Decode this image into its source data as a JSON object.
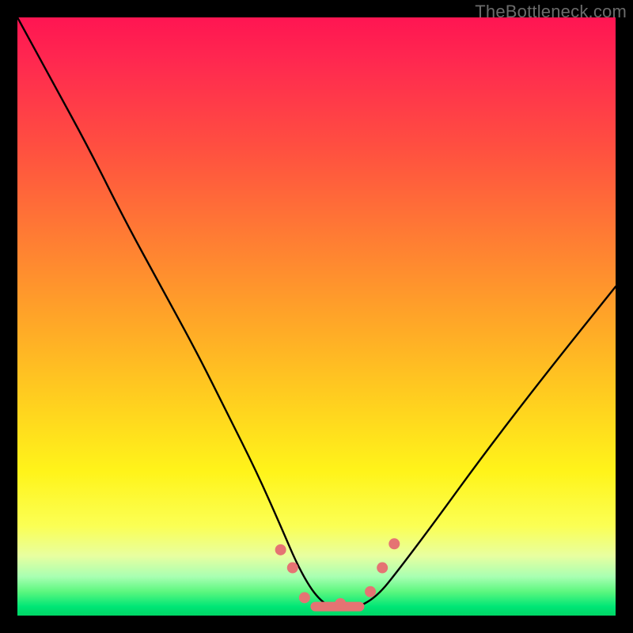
{
  "watermark": "TheBottleneck.com",
  "chart_data": {
    "type": "line",
    "title": "",
    "xlabel": "",
    "ylabel": "",
    "xlim": [
      0,
      100
    ],
    "ylim": [
      0,
      100
    ],
    "grid": false,
    "legend": false,
    "series": [
      {
        "name": "bottleneck-curve",
        "color": "#000000",
        "x": [
          0,
          6,
          12,
          18,
          24,
          30,
          35,
          40,
          44,
          47,
          50,
          53,
          56,
          60,
          64,
          70,
          78,
          88,
          100
        ],
        "y": [
          100,
          89,
          78,
          66,
          55,
          44,
          34,
          24,
          15,
          8,
          3,
          1,
          1,
          3,
          8,
          16,
          27,
          40,
          55
        ]
      }
    ],
    "markers": {
      "name": "bottom-dots",
      "color": "#e57373",
      "style": "rounded",
      "points": [
        {
          "x": 44,
          "y": 11
        },
        {
          "x": 46,
          "y": 8
        },
        {
          "x": 48,
          "y": 3
        },
        {
          "x": 54,
          "y": 2
        },
        {
          "x": 59,
          "y": 4
        },
        {
          "x": 61,
          "y": 8
        },
        {
          "x": 63,
          "y": 12
        }
      ],
      "bar": {
        "x_from": 49,
        "x_to": 58,
        "y": 1.5
      }
    },
    "background_gradient": {
      "top": "#ff1552",
      "mid": "#ffd21f",
      "bottom": "#00d666"
    }
  }
}
